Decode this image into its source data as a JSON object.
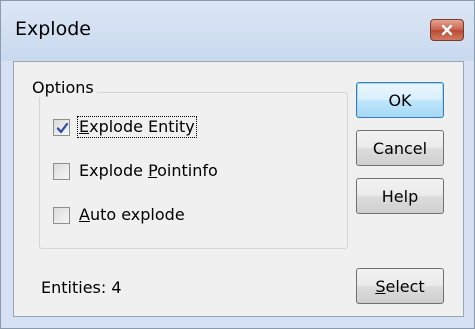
{
  "dialog": {
    "title": "Explode"
  },
  "options": {
    "group_label": "Options",
    "items": [
      {
        "pre": "",
        "accel": "E",
        "post": "xplode Entity",
        "checked": true
      },
      {
        "pre": "Explode ",
        "accel": "P",
        "post": "ointinfo",
        "checked": false
      },
      {
        "pre": "",
        "accel": "A",
        "post": "uto explode",
        "checked": false
      }
    ]
  },
  "buttons": {
    "ok_label": "OK",
    "cancel_label": "Cancel",
    "help_label": "Help",
    "select_accel": "S",
    "select_rest": "elect"
  },
  "status": {
    "entities_text": "Entities: 4"
  },
  "icons": {
    "close": "close-icon",
    "check": "checkmark-icon"
  },
  "colors": {
    "close_button": "#c7604b",
    "default_button_border": "#3c7fb1",
    "check_mark": "#2c4aa8"
  }
}
